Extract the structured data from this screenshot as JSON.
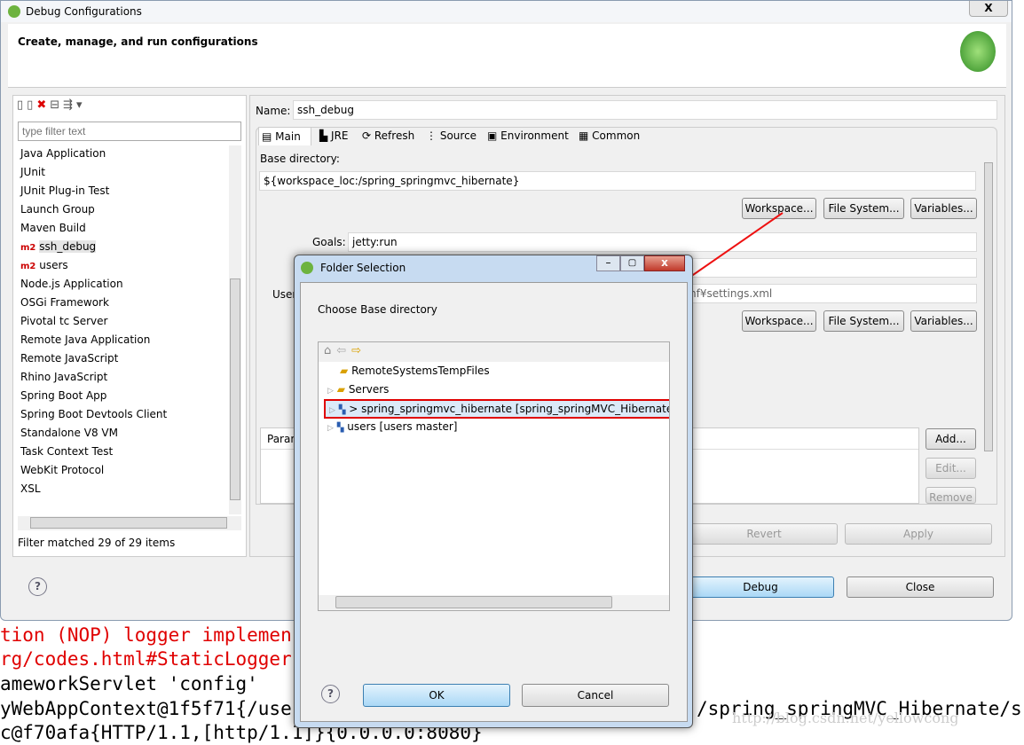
{
  "console": {
    "lines": [
      {
        "text": "tion (NOP) logger implemen",
        "color": "#e00000"
      },
      {
        "text": "rg/codes.html#StaticLogger",
        "color": "#e00000"
      },
      {
        "text": "ameworkServlet 'config'",
        "color": "#000000"
      },
      {
        "text": "yWebAppContext@1f5f71{/use",
        "color": "#000000"
      },
      {
        "text": "c@f70afa{HTTP/1.1,[http/1.1]}{0.0.0.0:8080}",
        "color": "#000000"
      }
    ],
    "right_text": "/spring_springMVC_Hibernate/s",
    "watermark": "http://blog.csdn.net/yellowcong"
  },
  "dialog": {
    "title": "Debug Configurations",
    "header": "Create, manage, and run configurations",
    "filter_placeholder": "type filter text",
    "config_types": [
      "Java Application",
      "JUnit",
      "JUnit Plug-in Test",
      "Launch Group",
      "Maven Build",
      "ssh_debug",
      "users",
      "Node.js Application",
      "OSGi Framework",
      "Pivotal tc Server",
      "Remote Java Application",
      "Remote JavaScript",
      "Rhino JavaScript",
      "Spring Boot App",
      "Spring Boot Devtools Client",
      "Standalone V8 VM",
      "Task Context Test",
      "WebKit Protocol",
      "XSL"
    ],
    "m2_badge": "m2",
    "filter_status": "Filter matched 29 of 29 items",
    "name_label": "Name:",
    "name_value": "ssh_debug",
    "tabs": [
      "Main",
      "JRE",
      "Refresh",
      "Source",
      "Environment",
      "Common"
    ],
    "base_dir_label": "Base directory:",
    "base_dir_value": "${workspace_loc:/spring_springmvc_hibernate}",
    "workspace_btn": "Workspace...",
    "filesystem_btn": "File System...",
    "variables_btn": "Variables...",
    "goals_label": "Goals:",
    "goals_value": "jetty:run",
    "user_settings_label": "User",
    "user_settings_value": "nf¥settings.xml",
    "param_header": "Param",
    "add_btn": "Add...",
    "edit_btn": "Edit...",
    "remove_btn": "Remove",
    "revert_btn": "Revert",
    "apply_btn": "Apply",
    "debug_btn": "Debug",
    "close_btn": "Close",
    "close_x": "X"
  },
  "folder_dialog": {
    "title": "Folder Selection",
    "prompt": "Choose Base directory",
    "items": [
      {
        "label": "RemoteSystemsTempFiles",
        "expandable": false
      },
      {
        "label": "Servers",
        "expandable": true
      },
      {
        "label": "> spring_springmvc_hibernate [spring_springMVC_Hibernate",
        "expandable": true,
        "selected": true
      },
      {
        "label": "users [users master]",
        "expandable": true
      }
    ],
    "ok": "OK",
    "cancel": "Cancel",
    "highlight_color": "#e00000"
  }
}
